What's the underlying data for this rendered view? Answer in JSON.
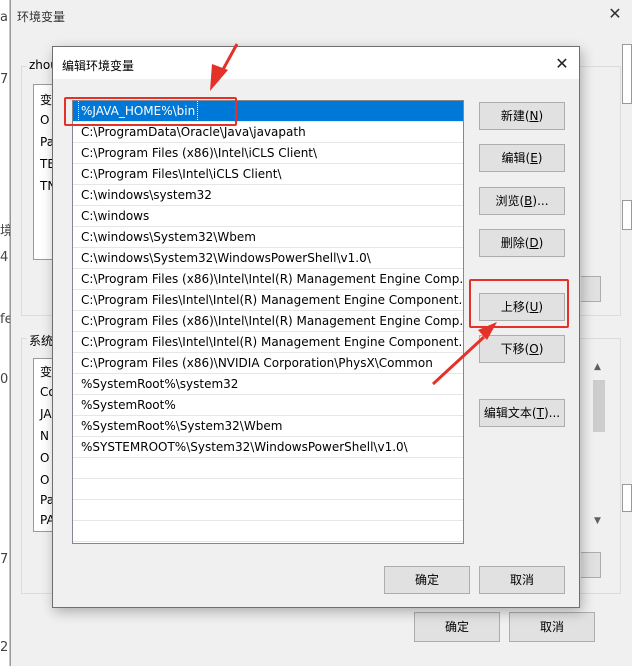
{
  "background": {
    "window_title": "环境变量",
    "left_strip_chars": [
      "a",
      "7",
      "境",
      "4",
      "fe",
      "0",
      "7",
      "2"
    ],
    "user_group_label": "zhou",
    "system_group_label": "系统",
    "user_list_fragments": [
      "变",
      "O",
      "Pa",
      "TE",
      "TN"
    ],
    "system_list_fragments": [
      "变",
      "Co",
      "JA",
      "N",
      "O",
      "O",
      "Pa",
      "PA"
    ],
    "ok_label": "确定",
    "cancel_label": "取消"
  },
  "dialog": {
    "title": "编辑环境变量",
    "paths": [
      "%JAVA_HOME%\\bin",
      "C:\\ProgramData\\Oracle\\Java\\javapath",
      "C:\\Program Files (x86)\\Intel\\iCLS Client\\",
      "C:\\Program Files\\Intel\\iCLS Client\\",
      "C:\\windows\\system32",
      "C:\\windows",
      "C:\\windows\\System32\\Wbem",
      "C:\\windows\\System32\\WindowsPowerShell\\v1.0\\",
      "C:\\Program Files (x86)\\Intel\\Intel(R) Management Engine Comp...",
      "C:\\Program Files\\Intel\\Intel(R) Management Engine Component...",
      "C:\\Program Files (x86)\\Intel\\Intel(R) Management Engine Comp...",
      "C:\\Program Files\\Intel\\Intel(R) Management Engine Component...",
      "C:\\Program Files (x86)\\NVIDIA Corporation\\PhysX\\Common",
      "%SystemRoot%\\system32",
      "%SystemRoot%",
      "%SystemRoot%\\System32\\Wbem",
      "%SYSTEMROOT%\\System32\\WindowsPowerShell\\v1.0\\"
    ],
    "buttons": {
      "new": {
        "text": "新建(",
        "key": "N",
        "end": ")"
      },
      "edit": {
        "text": "编辑(",
        "key": "E",
        "end": ")"
      },
      "browse": {
        "text": "浏览(",
        "key": "B",
        "end": ")..."
      },
      "delete": {
        "text": "删除(",
        "key": "D",
        "end": ")"
      },
      "move_up": {
        "text": "上移(",
        "key": "U",
        "end": ")"
      },
      "move_down": {
        "text": "下移(",
        "key": "O",
        "end": ")"
      },
      "edit_text": {
        "text": "编辑文本(",
        "key": "T",
        "end": ")..."
      }
    },
    "ok_label": "确定",
    "cancel_label": "取消"
  },
  "annotation_color": "#e53228",
  "selection_color": "#0078d7"
}
